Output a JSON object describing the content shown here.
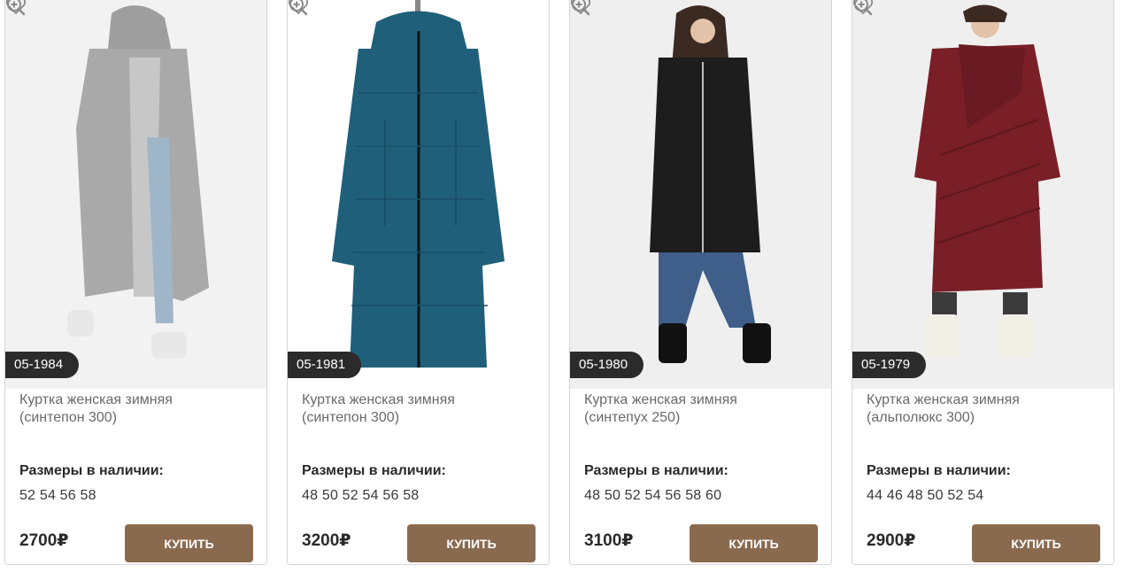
{
  "currency": "₽",
  "sizes_label": "Размеры в наличии:",
  "buy_label": "КУПИТЬ",
  "icons": {
    "zoom": "zoom-in-icon",
    "favorite": "heart-icon"
  },
  "colors": {
    "button": "#8a6a4f",
    "badge": "#2b2b2b"
  },
  "products": [
    {
      "sku": "05-1984",
      "title_line1": "Куртка женская зимняя",
      "title_line2": "(синтепон 300)",
      "sizes": "52 54 56 58",
      "price": "2700",
      "coat_color": "#a9a9a9"
    },
    {
      "sku": "05-1981",
      "title_line1": "Куртка женская зимняя",
      "title_line2": "(синтепон 300)",
      "sizes": "48 50 52 54 56 58",
      "price": "3200",
      "coat_color": "#1f5f7a"
    },
    {
      "sku": "05-1980",
      "title_line1": "Куртка женская зимняя",
      "title_line2": "(синтепух 250)",
      "sizes": "48 50 52 54 56 58 60",
      "price": "3100",
      "coat_color": "#1d1d1d"
    },
    {
      "sku": "05-1979",
      "title_line1": "Куртка женская зимняя",
      "title_line2": "(альполюкс 300)",
      "sizes": "44 46 48 50 52 54",
      "price": "2900",
      "coat_color": "#7a1f27"
    }
  ]
}
